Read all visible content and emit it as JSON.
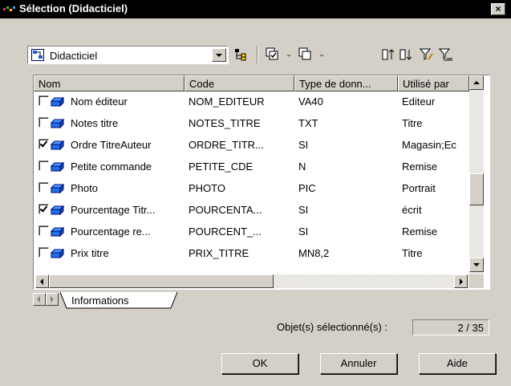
{
  "window": {
    "title": "Sélection (Didacticiel)",
    "close_glyph": "×"
  },
  "toolbar": {
    "model_value": "Didacticiel",
    "icons": [
      "model-icon",
      "dropdown-arrow",
      "properties-icon",
      "select-all-icon",
      "deselect-all-icon",
      "move-up-icon",
      "move-down-icon",
      "filter-icon",
      "clear-filter-icon"
    ]
  },
  "list": {
    "columns": [
      "Nom",
      "Code",
      "Type de donn...",
      "Utilisé par"
    ],
    "rows": [
      {
        "checked": false,
        "name": "Nom éditeur",
        "code": "NOM_EDITEUR",
        "type": "VA40",
        "used_by": "Editeur"
      },
      {
        "checked": false,
        "name": "Notes titre",
        "code": "NOTES_TITRE",
        "type": "TXT",
        "used_by": "Titre"
      },
      {
        "checked": true,
        "name": "Ordre TitreAuteur",
        "code": "ORDRE_TITR...",
        "type": "SI",
        "used_by": "Magasin;Ec"
      },
      {
        "checked": false,
        "name": "Petite commande",
        "code": "PETITE_CDE",
        "type": "N",
        "used_by": "Remise"
      },
      {
        "checked": false,
        "name": "Photo",
        "code": "PHOTO",
        "type": "PIC",
        "used_by": "Portrait"
      },
      {
        "checked": true,
        "name": "Pourcentage Titr...",
        "code": "POURCENTA...",
        "type": "SI",
        "used_by": "écrit"
      },
      {
        "checked": false,
        "name": "Pourcentage re...",
        "code": "POURCENT_...",
        "type": "SI",
        "used_by": "Remise"
      },
      {
        "checked": false,
        "name": "Prix titre",
        "code": "PRIX_TITRE",
        "type": "MN8,2",
        "used_by": "Titre"
      }
    ]
  },
  "tabs": [
    {
      "label": "Informations",
      "active": true
    }
  ],
  "status": {
    "label": "Objet(s) sélectionné(s) :",
    "value": "2 / 35"
  },
  "buttons": {
    "ok": "OK",
    "cancel": "Annuler",
    "help": "Aide"
  }
}
